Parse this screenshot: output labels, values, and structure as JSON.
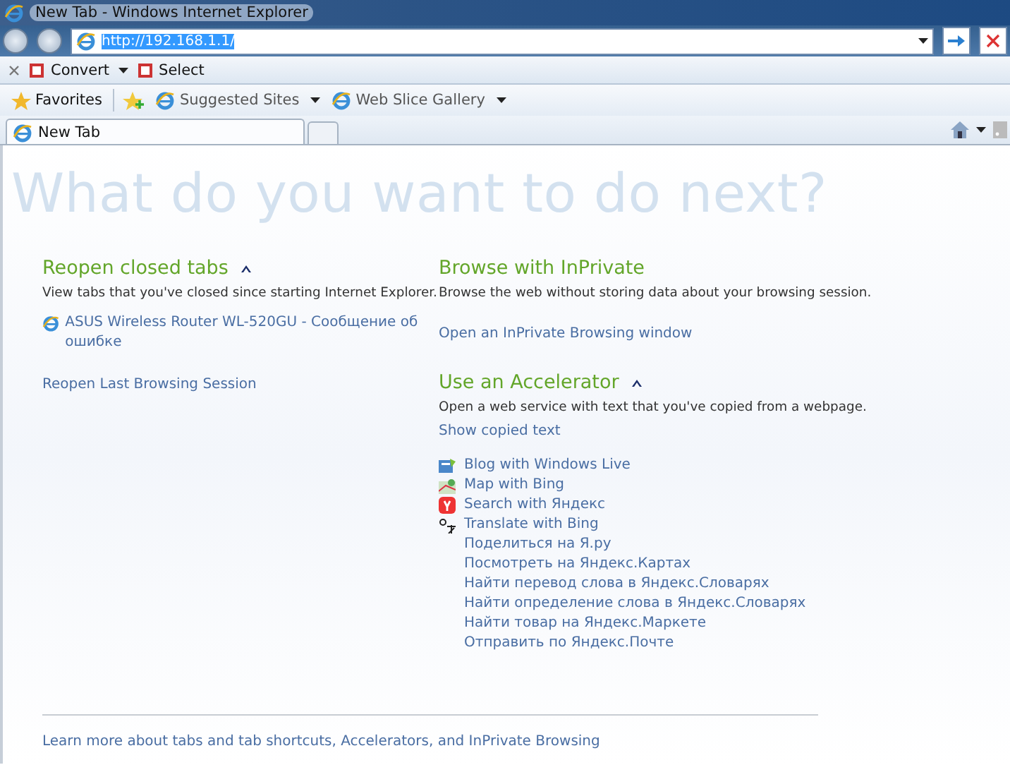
{
  "window": {
    "title": "New Tab - Windows Internet Explorer"
  },
  "address": {
    "value": "http://192.168.1.1/"
  },
  "command_bar": [
    "Convert",
    "Select"
  ],
  "favorites_bar": {
    "favorites": "Favorites",
    "links": [
      "Suggested Sites",
      "Web Slice Gallery"
    ]
  },
  "tabs": [
    {
      "label": "New Tab",
      "selected": true
    }
  ],
  "heading": "What do you want to do next?",
  "reopen": {
    "title": "Reopen closed tabs",
    "description": "View tabs that you've closed since starting Internet Explorer.",
    "closed_tabs": [
      "ASUS Wireless Router WL-520GU - Сообщение об ошибке"
    ],
    "last_session": "Reopen Last Browsing Session"
  },
  "inprivate": {
    "title": "Browse with InPrivate",
    "description": "Browse the web without storing data about your browsing session.",
    "link": "Open an InPrivate Browsing window"
  },
  "accelerators": {
    "title": "Use an Accelerator",
    "description": "Open a web service with text that you've copied from a webpage.",
    "show_copied": "Show copied text",
    "items": [
      {
        "label": "Blog with Windows Live",
        "kind": "blog"
      },
      {
        "label": "Map with Bing",
        "kind": "map"
      },
      {
        "label": "Search with Яндекс",
        "kind": "search"
      },
      {
        "label": "Translate with Bing",
        "kind": "translate"
      },
      {
        "label": "Поделиться на Я.ру",
        "kind": "plain"
      },
      {
        "label": "Посмотреть на Яндекс.Картах",
        "kind": "plain"
      },
      {
        "label": "Найти перевод слова в Яндекс.Словарях",
        "kind": "plain"
      },
      {
        "label": "Найти определение слова в Яндекс.Словарях",
        "kind": "plain"
      },
      {
        "label": "Найти товар на Яндекс.Маркете",
        "kind": "plain"
      },
      {
        "label": "Отправить по Яндекс.Почте",
        "kind": "plain"
      }
    ]
  },
  "footer_link": "Learn more about tabs and tab shortcuts, Accelerators, and InPrivate Browsing"
}
